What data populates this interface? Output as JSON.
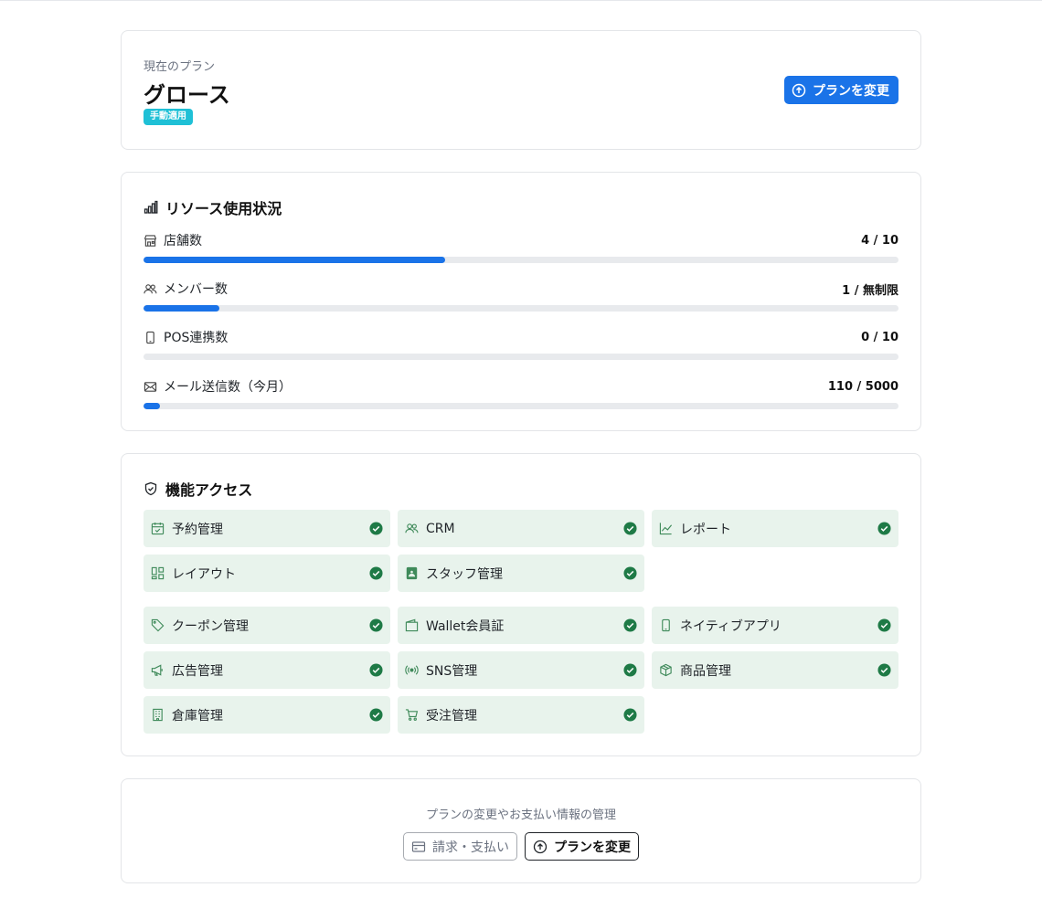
{
  "plan": {
    "label": "現在のプラン",
    "name": "グロース",
    "badge": "手動適用",
    "change_button": "プランを変更"
  },
  "resources": {
    "title": "リソース使用状況",
    "items": [
      {
        "icon": "store-icon",
        "label": "店舗数",
        "value": "4 / 10",
        "progress": 0.4
      },
      {
        "icon": "users-icon",
        "label": "メンバー数",
        "value": "1 / 無制限",
        "progress": 0.1
      },
      {
        "icon": "phone-icon",
        "label": "POS連携数",
        "value": "0 / 10",
        "progress": 0.0
      },
      {
        "icon": "mail-icon",
        "label": "メール送信数（今月）",
        "value": "110 / 5000",
        "progress": 0.022
      }
    ]
  },
  "features": {
    "title": "機能アクセス",
    "items": [
      {
        "icon": "calendar-check-icon",
        "label": "予約管理",
        "enabled": true
      },
      {
        "icon": "users-icon",
        "label": "CRM",
        "enabled": true
      },
      {
        "icon": "chart-line-icon",
        "label": "レポート",
        "enabled": true
      },
      {
        "icon": "layout-icon",
        "label": "レイアウト",
        "enabled": true
      },
      {
        "icon": "id-badge-icon",
        "label": "スタッフ管理",
        "enabled": true
      },
      {
        "icon": "tag-icon",
        "label": "クーポン管理",
        "enabled": true
      },
      {
        "icon": "wallet-icon",
        "label": "Wallet会員証",
        "enabled": true
      },
      {
        "icon": "phone-icon",
        "label": "ネイティブアプリ",
        "enabled": true
      },
      {
        "icon": "megaphone-icon",
        "label": "広告管理",
        "enabled": true
      },
      {
        "icon": "broadcast-icon",
        "label": "SNS管理",
        "enabled": true
      },
      {
        "icon": "box-icon",
        "label": "商品管理",
        "enabled": true
      },
      {
        "icon": "building-icon",
        "label": "倉庫管理",
        "enabled": true
      },
      {
        "icon": "cart-icon",
        "label": "受注管理",
        "enabled": true
      }
    ]
  },
  "footer": {
    "text": "プランの変更やお支払い情報の管理",
    "billing_button": "請求・支払い",
    "change_button": "プランを変更"
  },
  "colors": {
    "accent": "#1a73e8",
    "badge": "#1fc0d6",
    "feature_bg": "#e8f3ec",
    "check": "#1e7a46"
  }
}
